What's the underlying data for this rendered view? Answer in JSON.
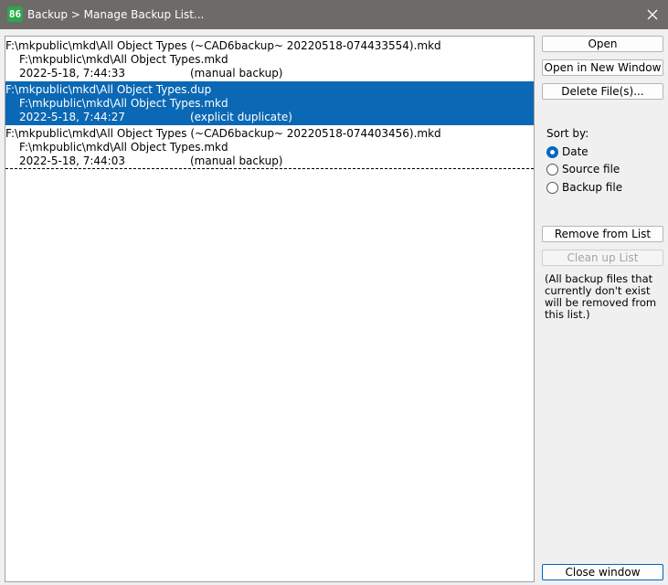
{
  "window": {
    "app_icon": "86",
    "title": "Backup > Manage Backup List..."
  },
  "entries": [
    {
      "line1": "F:\\mkpublic\\mkd\\All Object Types (~CAD6backup~ 20220518-074433554).mkd",
      "line2": "F:\\mkpublic\\mkd\\All Object Types.mkd",
      "date": "2022-5-18, 7:44:33",
      "note": "(manual backup)"
    },
    {
      "line1": "F:\\mkpublic\\mkd\\All Object Types.dup",
      "line2": "F:\\mkpublic\\mkd\\All Object Types.mkd",
      "date": "2022-5-18, 7:44:27",
      "note": "(explicit duplicate)"
    },
    {
      "line1": "F:\\mkpublic\\mkd\\All Object Types (~CAD6backup~ 20220518-074403456).mkd",
      "line2": "F:\\mkpublic\\mkd\\All Object Types.mkd",
      "date": "2022-5-18, 7:44:03",
      "note": "(manual backup)"
    }
  ],
  "buttons": {
    "open": "Open",
    "open_new_window": "Open in New Window",
    "delete_files": "Delete File(s)...",
    "remove_from_list": "Remove from List",
    "clean_up_list": "Clean up List",
    "close_window": "Close window"
  },
  "sort": {
    "label": "Sort by:",
    "options": [
      "Date",
      "Source file",
      "Backup file"
    ],
    "selected": "Date"
  },
  "cleanup_note": "(All backup files that currently don't exist will be removed from this list.)",
  "colors": {
    "selection": "#0b68b4",
    "titlebar": "#6e6a67",
    "accent": "#0067c0"
  }
}
